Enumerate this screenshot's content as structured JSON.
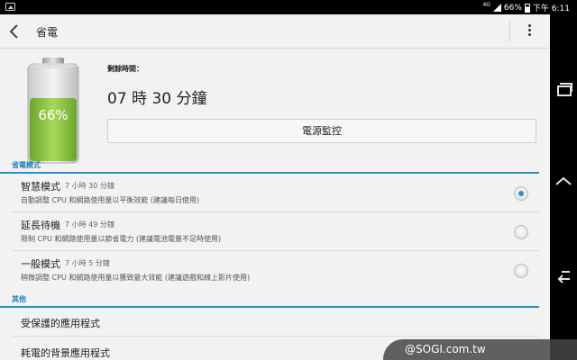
{
  "status_bar": {
    "network": "4G",
    "battery_percent": "66%",
    "time": "下午 6:11",
    "battery_level": 0.66
  },
  "header": {
    "title": "省電",
    "back_icon": "back-chevron-icon",
    "menu_icon": "overflow-menu-icon"
  },
  "battery": {
    "percent_label": "66%",
    "level": 0.66,
    "fill_color": "#8cc63e",
    "remaining_label": "剩餘時間：",
    "remaining_value": "07 時 30 分鐘",
    "monitor_button": "電源監控"
  },
  "power_modes": {
    "section_title": "省電模式",
    "items": [
      {
        "name": "智慧模式",
        "time": "7 小時 30 分鐘",
        "description": "自動調整 CPU 和網路使用量以平衡效能 (建議每日使用)",
        "selected": true
      },
      {
        "name": "延長待機",
        "time": "7 小時 49 分鐘",
        "description": "限制 CPU 和網路使用量以節省電力 (建議電池電量不足時使用)",
        "selected": false
      },
      {
        "name": "一般模式",
        "time": "7 小時 5 分鐘",
        "description": "稍微調整 CPU 和網路使用量以獲致最大效能 (建議遊戲和線上影片使用)",
        "selected": false
      }
    ]
  },
  "other": {
    "section_title": "其他",
    "items": [
      {
        "label": "受保護的應用程式"
      },
      {
        "label": "耗電的背景應用程式"
      }
    ]
  },
  "nav": {
    "recent_icon": "recent-apps-icon",
    "home_icon": "home-icon",
    "back_icon": "back-icon"
  },
  "watermark": "@SOGI.com.tw",
  "colors": {
    "accent": "#2b90c7",
    "battery_green": "#8cc63e",
    "background": "#f2f2f2"
  }
}
